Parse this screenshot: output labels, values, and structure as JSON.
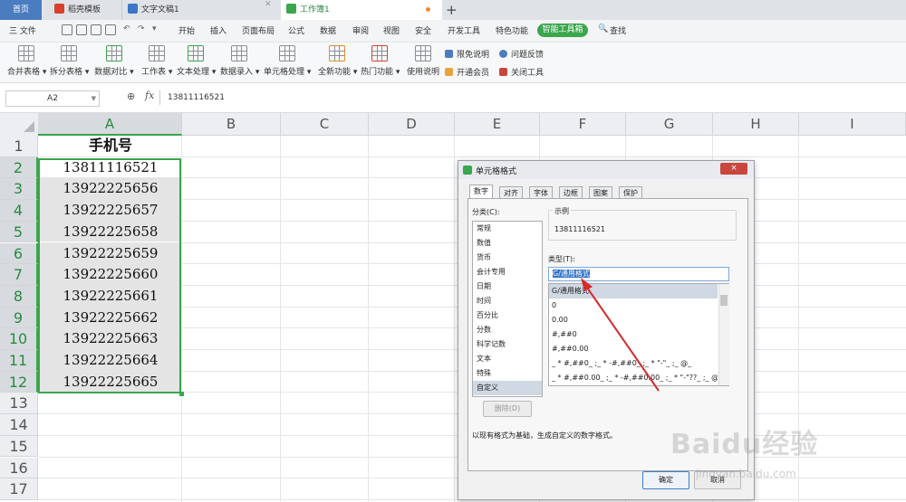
{
  "tabs": {
    "home": "首页",
    "wps": "稻壳模板",
    "doc": "文字文稿1",
    "book": "工作簿1",
    "new_tab": "+"
  },
  "menubar": {
    "file": "三 文件",
    "items": [
      "开始",
      "插入",
      "页面布局",
      "公式",
      "数据",
      "审阅",
      "视图",
      "安全",
      "开发工具",
      "特色功能"
    ],
    "smart_tools": "智能工具箱",
    "search": "查找"
  },
  "ribbon": {
    "buttons": [
      "合并表格",
      "拆分表格",
      "数据对比",
      "工作表",
      "文本处理",
      "数据录入",
      "单元格处理",
      "全新功能",
      "热门功能",
      "使用说明"
    ],
    "small": [
      "限免说明",
      "开通会员",
      "问题反馈",
      "关闭工具"
    ]
  },
  "formula_bar": {
    "name_box": "A2",
    "value": "13811116521"
  },
  "sheet": {
    "columns": [
      "A",
      "B",
      "C",
      "D",
      "E",
      "F",
      "G",
      "H",
      "I"
    ],
    "rows": [
      "1",
      "2",
      "3",
      "4",
      "5",
      "6",
      "7",
      "8",
      "9",
      "10",
      "11",
      "12",
      "13",
      "14",
      "15",
      "16",
      "17"
    ],
    "cells": [
      "手机号",
      "13811116521",
      "13922225656",
      "13922225657",
      "13922225658",
      "13922225659",
      "13922225660",
      "13922225661",
      "13922225662",
      "13922225663",
      "13922225664",
      "13922225665"
    ]
  },
  "dialog": {
    "title": "单元格格式",
    "close": "×",
    "tabs": [
      "数字",
      "对齐",
      "字体",
      "边框",
      "图案",
      "保护"
    ],
    "category_label": "分类(C):",
    "categories": [
      "常规",
      "数值",
      "货币",
      "会计专用",
      "日期",
      "时间",
      "百分比",
      "分数",
      "科学记数",
      "文本",
      "特殊",
      "自定义"
    ],
    "delete_button": "删除(D)",
    "sample_label": "示例",
    "sample_value": "13811116521",
    "type_label": "类型(T):",
    "type_value": "G/通用格式",
    "type_options": [
      "G/通用格式",
      "0",
      "0.00",
      "#,##0",
      "#,##0.00",
      "_ * #,##0_ ;_ * -#,##0_ ;_ * \"-\"_ ;_ @_",
      "_ * #,##0.00_ ;_ * -#,##0.00_ ;_ * \"-\"??_ ;_ @_"
    ],
    "description": "以现有格式为基础，生成自定义的数字格式。",
    "ok": "确定",
    "cancel": "取消"
  },
  "watermark": {
    "brand": "Baidu经验",
    "url": "jingyan.baidu.com"
  },
  "colors": {
    "accent_green": "#3aa64d",
    "annotation_red": "#d42a2a"
  }
}
